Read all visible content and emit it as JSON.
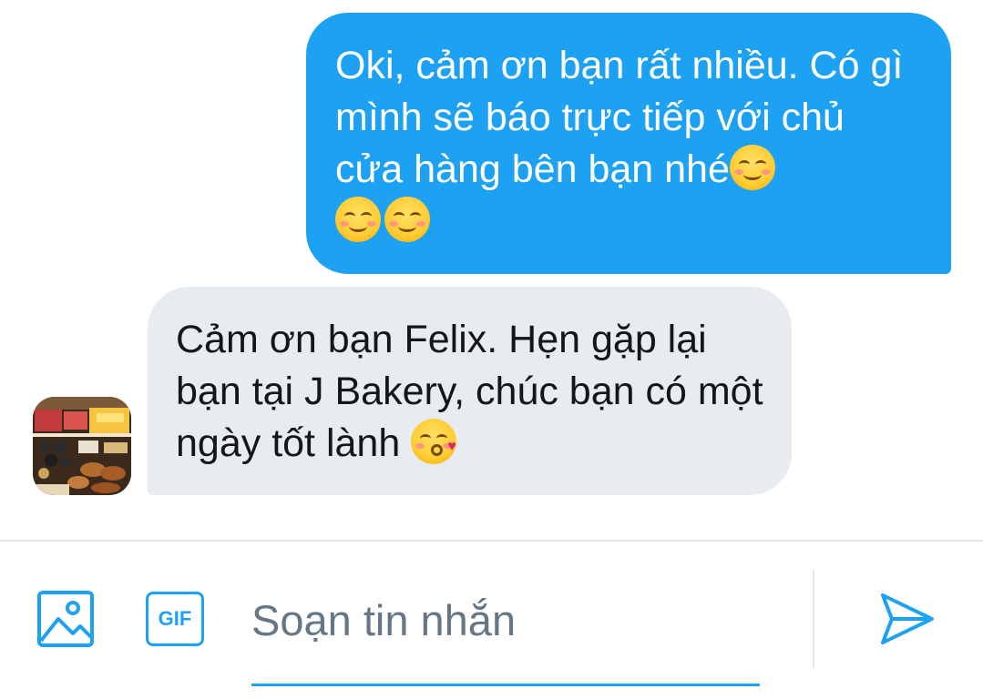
{
  "conversation": {
    "messages": [
      {
        "direction": "outgoing",
        "text": "Oki, cảm ơn bạn rất nhiều. Có gì mình sẽ báo trực tiếp với chủ cửa hàng bên bạn nhé",
        "emojis": [
          "smiling-face-icon",
          "smiling-face-icon",
          "smiling-face-icon"
        ]
      },
      {
        "direction": "incoming",
        "text": "Cảm ơn bạn Felix. Hẹn gặp lại bạn tại J Bakery, chúc bạn có một ngày tốt lành",
        "emojis": [
          "face-blowing-kiss-icon"
        ],
        "avatar": "bakery-avatar"
      }
    ]
  },
  "composer": {
    "placeholder": "Soạn tin nhắn",
    "value": "",
    "gif_label": "GIF",
    "image_icon": "image-icon",
    "send_icon": "send-icon"
  },
  "colors": {
    "accent": "#1da1f2",
    "incoming_bubble": "#e6ecf0",
    "text_primary": "#14171a",
    "placeholder": "#657786"
  }
}
